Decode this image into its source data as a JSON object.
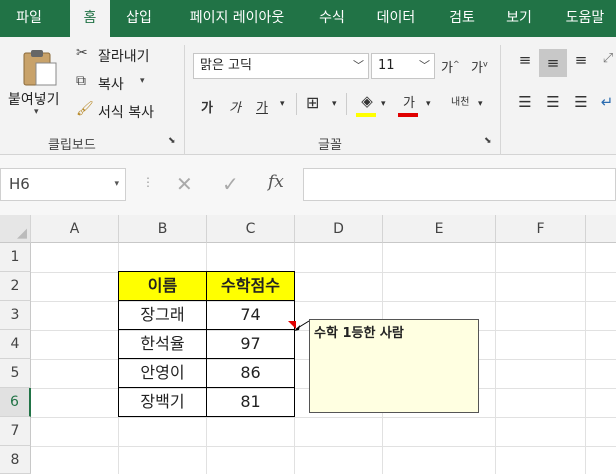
{
  "tabs": [
    "파일",
    "홈",
    "삽입",
    "페이지 레이아웃",
    "수식",
    "데이터",
    "검토",
    "보기",
    "도움말"
  ],
  "clipboard": {
    "paste": "붙여넣기",
    "cut": "잘라내기",
    "copy": "복사",
    "format_painter": "서식 복사",
    "group_label": "클립보드"
  },
  "font": {
    "name": "맑은 고딕",
    "size": "11",
    "group_label": "글꼴",
    "grow": "가",
    "shrink": "가",
    "bold": "가",
    "italic": "가",
    "underline": "가",
    "font_color": "가",
    "phonetic": "내천"
  },
  "formula_bar": {
    "name_box": "H6",
    "fx": "fx",
    "value": ""
  },
  "columns": [
    "A",
    "B",
    "C",
    "D",
    "E",
    "F"
  ],
  "rows": [
    "1",
    "2",
    "3",
    "4",
    "5",
    "6",
    "7",
    "8"
  ],
  "table": {
    "headers": [
      "이름",
      "수학점수"
    ],
    "rows": [
      [
        "장그래",
        "74"
      ],
      [
        "한석율",
        "97"
      ],
      [
        "안영이",
        "86"
      ],
      [
        "장백기",
        "81"
      ]
    ]
  },
  "comment": "수학 1등한 사람",
  "colors": {
    "accent": "#217346",
    "header_fill": "#ffff00",
    "comment_fill": "#ffffe1"
  }
}
